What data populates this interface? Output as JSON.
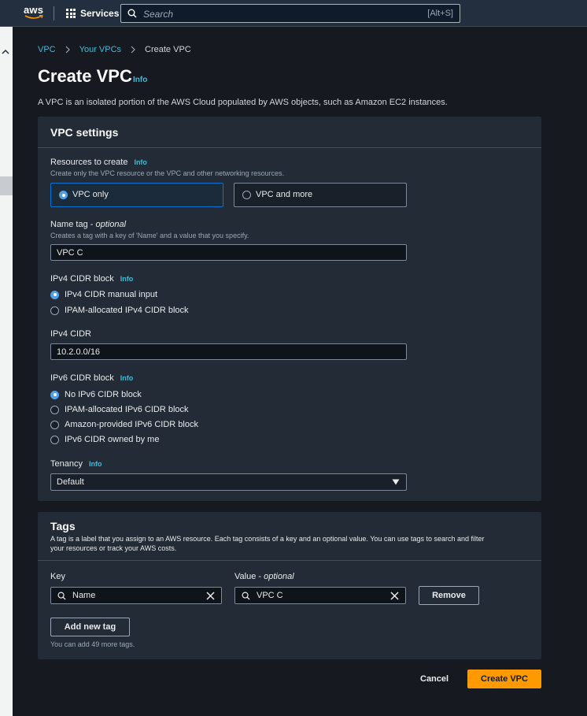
{
  "topnav": {
    "logo_text": "aws",
    "services_label": "Services",
    "search_placeholder": "Search",
    "search_shortcut": "[Alt+S]"
  },
  "breadcrumb": {
    "item1": "VPC",
    "item2": "Your VPCs",
    "current": "Create VPC"
  },
  "page": {
    "title": "Create VPC",
    "info": "Info",
    "description": "A VPC is an isolated portion of the AWS Cloud populated by AWS objects, such as Amazon EC2 instances."
  },
  "vpc_settings": {
    "title": "VPC settings",
    "resources": {
      "label": "Resources to create",
      "info": "Info",
      "hint": "Create only the VPC resource or the VPC and other networking resources.",
      "option_vpc_only": "VPC only",
      "option_vpc_more": "VPC and more",
      "selected": "VPC only"
    },
    "name_tag": {
      "label": "Name tag",
      "optional": "optional",
      "hint": "Creates a tag with a key of 'Name' and a value that you specify.",
      "value": "VPC C"
    },
    "ipv4_block": {
      "label": "IPv4 CIDR block",
      "info": "Info",
      "options": [
        "IPv4 CIDR manual input",
        "IPAM-allocated IPv4 CIDR block"
      ],
      "selected": "IPv4 CIDR manual input"
    },
    "ipv4_cidr": {
      "label": "IPv4 CIDR",
      "value": "10.2.0.0/16"
    },
    "ipv6_block": {
      "label": "IPv6 CIDR block",
      "info": "Info",
      "options": [
        "No IPv6 CIDR block",
        "IPAM-allocated IPv6 CIDR block",
        "Amazon-provided IPv6 CIDR block",
        "IPv6 CIDR owned by me"
      ],
      "selected": "No IPv6 CIDR block"
    },
    "tenancy": {
      "label": "Tenancy",
      "info": "Info",
      "value": "Default"
    }
  },
  "tags": {
    "title": "Tags",
    "description_line1": "A tag is a label that you assign to an AWS resource. Each tag consists of a key and an optional value. You can use tags to search and filter",
    "description_line2": "your resources or track your AWS costs.",
    "key_label": "Key",
    "value_label": "Value",
    "value_optional": "optional",
    "key_value": "Name",
    "value_value": "VPC C",
    "remove_label": "Remove",
    "add_label": "Add new tag",
    "remaining_hint": "You can add 49 more tags."
  },
  "footer": {
    "cancel_label": "Cancel",
    "create_label": "Create VPC"
  },
  "colors": {
    "accent_link": "#44b9d6",
    "primary_button": "#ff9900",
    "selected_border": "#0972d3",
    "nav_bg": "#232f3e"
  }
}
